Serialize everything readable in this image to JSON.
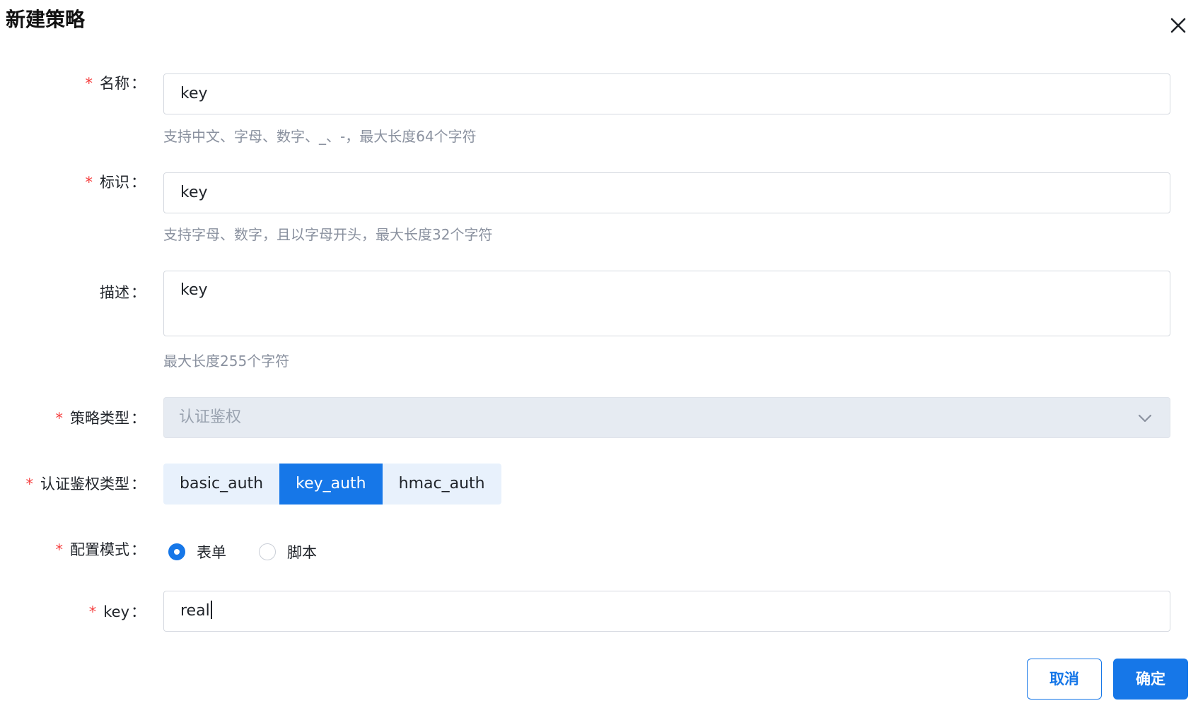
{
  "dialog": {
    "title": "新建策略"
  },
  "form": {
    "name": {
      "required_mark": "*",
      "label": "名称",
      "colon": "：",
      "value": "key",
      "hint": "支持中文、字母、数字、_、-，最大长度64个字符"
    },
    "identifier": {
      "required_mark": "*",
      "label": "标识",
      "colon": "：",
      "value": "key",
      "hint": "支持字母、数字，且以字母开头，最大长度32个字符"
    },
    "description": {
      "label": "描述",
      "colon": "：",
      "value": "key",
      "hint": "最大长度255个字符"
    },
    "policy_type": {
      "required_mark": "*",
      "label": "策略类型",
      "colon": "：",
      "value": "认证鉴权",
      "icon": "chevron-down-icon"
    },
    "auth_type": {
      "required_mark": "*",
      "label": "认证鉴权类型",
      "colon": "：",
      "options": [
        "basic_auth",
        "key_auth",
        "hmac_auth"
      ],
      "selected": "key_auth"
    },
    "config_mode": {
      "required_mark": "*",
      "label": "配置模式",
      "colon": "：",
      "options": [
        "表单",
        "脚本"
      ],
      "selected": "表单"
    },
    "key": {
      "required_mark": "*",
      "label": "key",
      "colon": "：",
      "value": "real"
    }
  },
  "footer": {
    "cancel_label": "取消",
    "ok_label": "确定"
  },
  "colors": {
    "primary": "#1677e8",
    "required": "#f53f3f",
    "hint": "#8a919f",
    "disabled_bg": "#e6ebf2"
  }
}
